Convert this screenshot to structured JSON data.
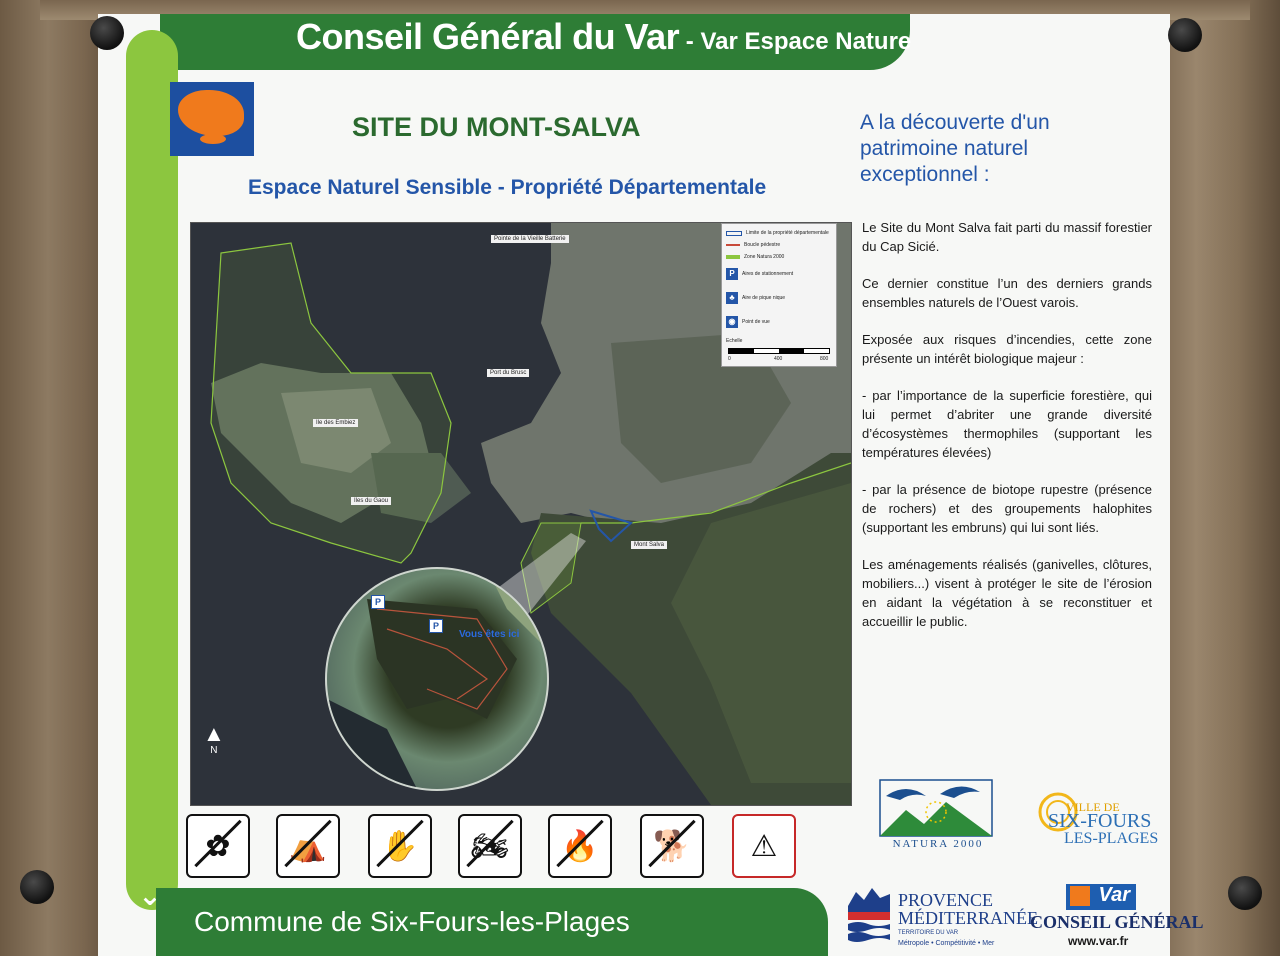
{
  "header": {
    "main": "Conseil Général du Var",
    "sub": " - Var Espace Nature"
  },
  "title": "SITE DU MONT-SALVA",
  "subtitle": "Espace Naturel Sensible - Propriété Départementale",
  "right": {
    "heading": "A la découverte d'un patrimoine naturel exceptionnel :",
    "paragraphs": [
      "Le Site du Mont Salva fait parti du massif forestier du Cap Sicié.",
      "Ce dernier constitue l’un des derniers grands ensembles naturels de l’Ouest varois.",
      "Exposée aux risques d’incendies, cette zone présente un intérêt biologique majeur :",
      "- par l’importance de la superficie forestière, qui lui permet d’abriter une grande diversité d’écosystèmes thermophiles (supportant les températures élevées)",
      "- par la présence de biotope rupestre (présence de rochers) et des groupements halophites (supportant les embruns) qui lui sont liés.",
      "Les aménagements réalisés (ganivelles, clôtures, mobiliers...) visent à protéger le site de l’érosion en aidant la végétation à se reconstituer et accueillir le public."
    ]
  },
  "map": {
    "labels": {
      "pointe": "Pointe de la Vieille Batterie",
      "port": "Port du Brusc",
      "ile_embiez": "Ile des Embiez",
      "ile_gaou": "Iles du Gaou",
      "mont_salva": "Mont Salva"
    },
    "legend": {
      "limite": "Limite de la propriété départementale",
      "boucle": "Boucle pédestre",
      "natura": "Zone Natura 2000",
      "parking": "Aires de stationnement",
      "pique_nique": "Aire de pique nique",
      "point_vue": "Point de vue",
      "echelle": "Echelle",
      "scale_0": "0",
      "scale_400": "400",
      "scale_800": "800"
    },
    "inset_label": "Vous êtes ici",
    "north": "N",
    "p_label": "P"
  },
  "pictograms": [
    {
      "name": "no-picking-flowers-icon",
      "glyph": "✿"
    },
    {
      "name": "no-camping-icon",
      "glyph": "⛺"
    },
    {
      "name": "no-littering-icon",
      "glyph": "✋"
    },
    {
      "name": "no-motorbikes-icon",
      "glyph": "🏍"
    },
    {
      "name": "no-fire-icon",
      "glyph": "🔥"
    },
    {
      "name": "no-dogs-icon",
      "glyph": "🐕"
    },
    {
      "name": "danger-cliff-icon",
      "glyph": "⚠"
    }
  ],
  "footer": {
    "commune": "Commune de Six-Fours-les-Plages",
    "natura": "NATURA 2000",
    "sixfours_l1": "VILLE DE",
    "sixfours_l2": "SIX-FOURS",
    "sixfours_l3": "LES-PLAGES",
    "provence_l1": "PROVENCE",
    "provence_l2": "MÉDITERRANÉE",
    "provence_l3": "TERRITOIRE DU VAR",
    "provence_l4": "Métropole • Compétitivité • Mer",
    "var_badge": "Var",
    "cg": "CONSEIL GÉNÉRAL",
    "url": "www.var.fr"
  },
  "colors": {
    "green_dark": "#2e7d36",
    "green_light": "#8cc63f",
    "blue": "#2456a8",
    "orange": "#f07a1c"
  }
}
